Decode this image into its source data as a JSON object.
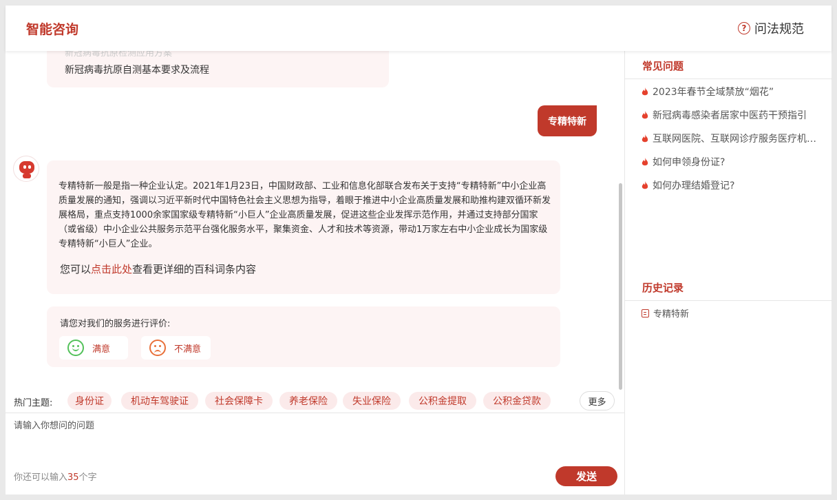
{
  "header": {
    "logo": "智能咨询",
    "help_icon_glyph": "?",
    "help_link": "问法规范"
  },
  "chat": {
    "prev_bubble_faded": "新冠病毒抗原检测应用方案",
    "prev_bubble_text": "新冠病毒抗原自测基本要求及流程",
    "user_message": "专精特新",
    "bot_answer": "专精特新一般是指一种企业认定。2021年1月23日，中国财政部、工业和信息化部联合发布关于支持“专精特新”中小企业高质量发展的通知，强调以习近平新时代中国特色社会主义思想为指导，着眼于推进中小企业高质量发展和助推构建双循环新发展格局，重点支持1000余家国家级专精特新“小巨人”企业高质量发展，促进这些企业发挥示范作用，并通过支持部分国家（或省级）中小企业公共服务示范平台强化服务水平，聚集资金、人才和技术等资源，带动1万家左右中小企业成长为国家级专精特新“小巨人”企业。",
    "more_prefix": "您可以",
    "more_link": "点击此处",
    "more_suffix": "查看更详细的百科词条内容",
    "rating_question": "请您对我们的服务进行评价:",
    "satisfied": "满意",
    "unsatisfied": "不满意"
  },
  "topics": {
    "label": "热门主题:",
    "tags": [
      "身份证",
      "机动车驾驶证",
      "社会保障卡",
      "养老保险",
      "失业保险",
      "公积金提取",
      "公积金贷款"
    ],
    "more": "更多"
  },
  "input": {
    "placeholder": "请输入你想问的问题",
    "counter_prefix": "你还可以输入",
    "counter_num": "35",
    "counter_suffix": "个字",
    "send": "发送"
  },
  "sidebar": {
    "faq_title": "常见问题",
    "faq": [
      "2023年春节全域禁放“烟花”",
      "新冠病毒感染者居家中医药干预指引",
      "互联网医院、互联网诊疗服务医疗机构名单",
      "如何申领身份证?",
      "如何办理结婚登记?"
    ],
    "history_title": "历史记录",
    "history": [
      "专精特新"
    ]
  },
  "colors": {
    "accent": "#c0392b",
    "bubble": "#fdf4f4",
    "tag_bg": "#fbeaea"
  }
}
